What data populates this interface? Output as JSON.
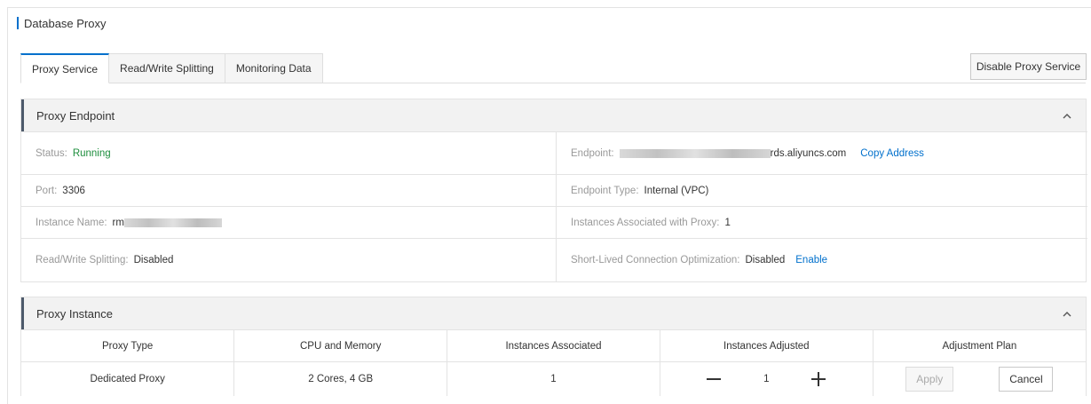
{
  "page": {
    "title": "Database Proxy"
  },
  "tabs": [
    {
      "label": "Proxy Service",
      "active": true
    },
    {
      "label": "Read/Write Splitting",
      "active": false
    },
    {
      "label": "Monitoring Data",
      "active": false
    }
  ],
  "toolbar": {
    "disable_label": "Disable Proxy Service"
  },
  "endpoint_panel": {
    "title": "Proxy Endpoint",
    "status": {
      "label": "Status:",
      "value": "Running"
    },
    "endpoint": {
      "label": "Endpoint:",
      "value_suffix": "rds.aliyuncs.com",
      "copy_label": "Copy Address"
    },
    "port": {
      "label": "Port:",
      "value": "3306"
    },
    "endpoint_type": {
      "label": "Endpoint Type:",
      "value": "Internal (VPC)"
    },
    "instance_name": {
      "label": "Instance Name:",
      "value_prefix": "rm"
    },
    "instances_associated": {
      "label": "Instances Associated with Proxy:",
      "value": "1"
    },
    "rw_splitting": {
      "label": "Read/Write Splitting:",
      "value": "Disabled"
    },
    "short_lived": {
      "label": "Short-Lived Connection Optimization:",
      "value": "Disabled",
      "action_label": "Enable"
    }
  },
  "instance_panel": {
    "title": "Proxy Instance",
    "columns": [
      "Proxy Type",
      "CPU and Memory",
      "Instances Associated",
      "Instances Adjusted",
      "Adjustment Plan"
    ],
    "row": {
      "proxy_type": "Dedicated Proxy",
      "cpu_memory": "2 Cores, 4 GB",
      "instances_associated": "1",
      "instances_adjusted": "1",
      "apply_label": "Apply",
      "cancel_label": "Cancel"
    }
  },
  "colors": {
    "accent": "#0070cc",
    "running": "#1e8e3e",
    "panel_header": "#f2f2f2"
  },
  "icons": [
    "chevron-up-icon",
    "minus-icon",
    "plus-icon"
  ]
}
